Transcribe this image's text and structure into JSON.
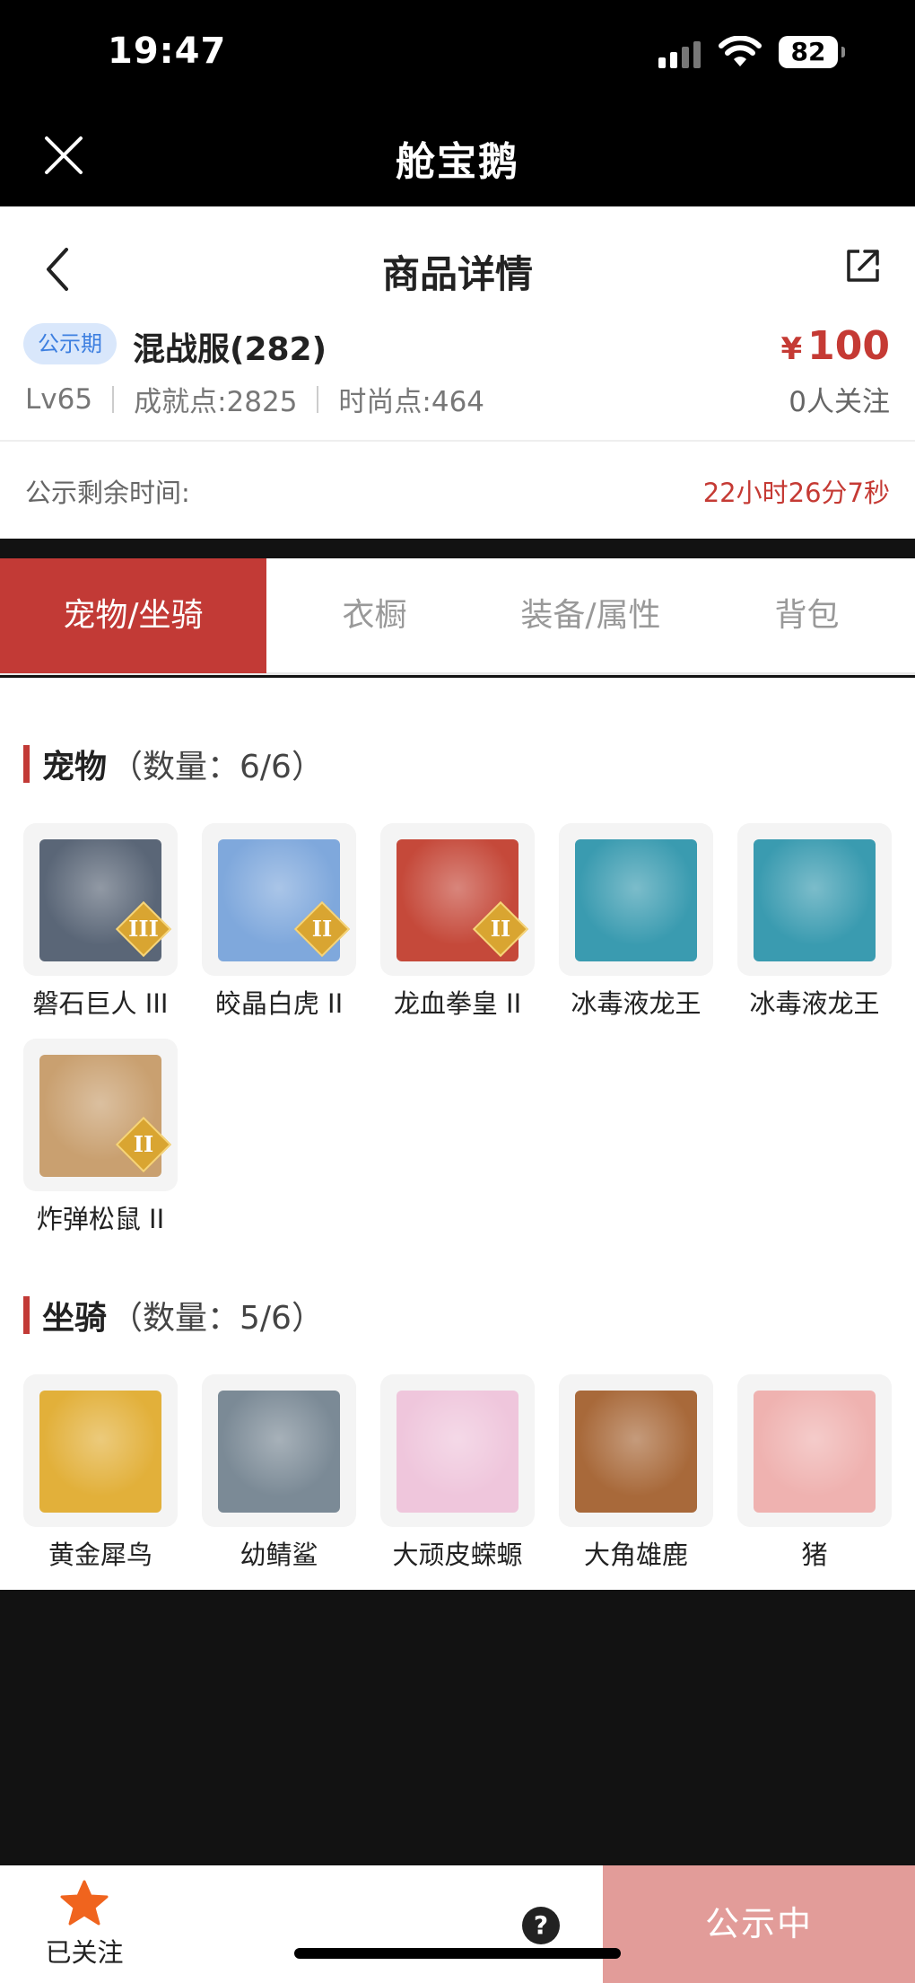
{
  "status": {
    "time": "19:47",
    "battery": "82"
  },
  "app": {
    "title": "舱宝鹅"
  },
  "detail": {
    "title": "商品详情",
    "badge": "公示期",
    "server": "混战服(282)",
    "price_symbol": "¥",
    "price": "100",
    "level": "Lv65",
    "achievement": "成就点:2825",
    "fashion": "时尚点:464",
    "followers": "0人关注",
    "remaining_label": "公示剩余时间:",
    "remaining_value": "22小时26分7秒"
  },
  "tabs": [
    {
      "label": "宠物/坐骑",
      "active": true
    },
    {
      "label": "衣橱",
      "active": false
    },
    {
      "label": "装备/属性",
      "active": false
    },
    {
      "label": "背包",
      "active": false
    }
  ],
  "pets": {
    "title": "宠物",
    "count": "（数量：6/6）",
    "items": [
      {
        "label": "磐石巨人 III",
        "tier": "III",
        "icon": "stone-giant-pet-icon",
        "color": "#5a6677"
      },
      {
        "label": "皎晶白虎 II",
        "tier": "II",
        "icon": "white-tiger-pet-icon",
        "color": "#7fa8dc"
      },
      {
        "label": "龙血拳皇 II",
        "tier": "II",
        "icon": "dragon-fist-pet-icon",
        "color": "#c5493a"
      },
      {
        "label": "冰毒液龙王",
        "tier": "",
        "icon": "venom-dragon-pet-icon",
        "color": "#3a9bb0"
      },
      {
        "label": "冰毒液龙王",
        "tier": "",
        "icon": "venom-dragon-pet-icon",
        "color": "#3a9bb0"
      },
      {
        "label": "炸弹松鼠 II",
        "tier": "II",
        "icon": "bomb-squirrel-pet-icon",
        "color": "#c9a070"
      }
    ]
  },
  "mounts": {
    "title": "坐骑",
    "count": "（数量：5/6）",
    "items": [
      {
        "label": "黄金犀鸟",
        "icon": "golden-hornbill-mount-icon",
        "color": "#e2b03a"
      },
      {
        "label": "幼鲭鲨",
        "icon": "young-shark-mount-icon",
        "color": "#7b8a96"
      },
      {
        "label": "大顽皮蝾螈",
        "icon": "axolotl-mount-icon",
        "color": "#efc6dc"
      },
      {
        "label": "大角雄鹿",
        "icon": "stag-mount-icon",
        "color": "#a8693a"
      },
      {
        "label": "猪",
        "icon": "pig-mount-icon",
        "color": "#efb2b0"
      }
    ]
  },
  "bottom": {
    "follow_label": "已关注",
    "help": "?",
    "status_button": "公示中"
  }
}
